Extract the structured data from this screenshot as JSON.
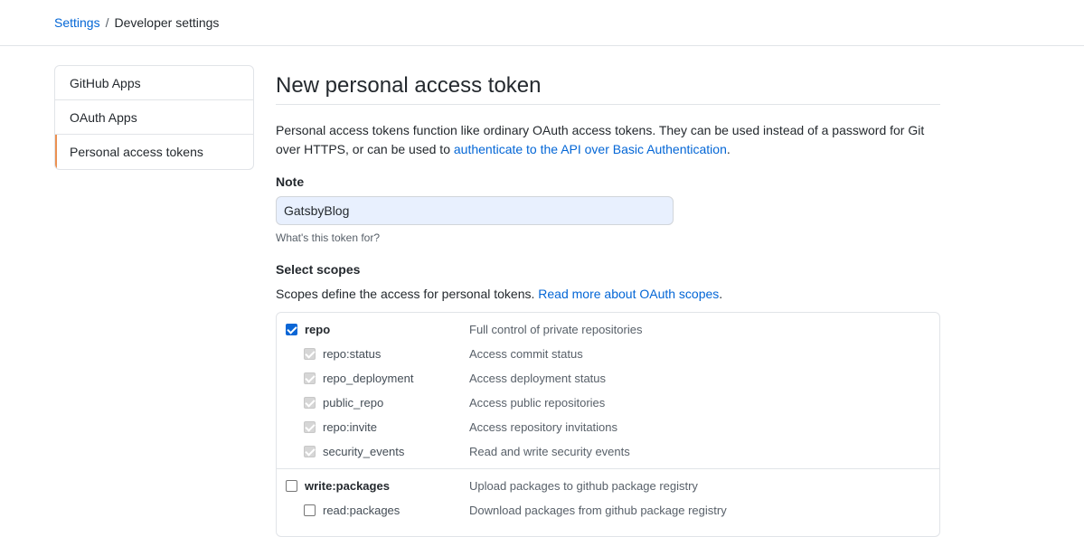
{
  "breadcrumb": {
    "root": "Settings",
    "separator": "/",
    "current": "Developer settings"
  },
  "sidebar": {
    "items": [
      {
        "label": "GitHub Apps"
      },
      {
        "label": "OAuth Apps"
      },
      {
        "label": "Personal access tokens"
      }
    ]
  },
  "main": {
    "title": "New personal access token",
    "description_prefix": "Personal access tokens function like ordinary OAuth access tokens. They can be used instead of a password for Git over HTTPS, or can be used to ",
    "description_link": "authenticate to the API over Basic Authentication",
    "description_suffix": ".",
    "note_label": "Note",
    "note_value": "GatsbyBlog",
    "note_hint": "What's this token for?",
    "scopes_label": "Select scopes",
    "scopes_desc_prefix": "Scopes define the access for personal tokens. ",
    "scopes_desc_link": "Read more about OAuth scopes",
    "scopes_desc_suffix": ".",
    "scope_groups": [
      {
        "name": "repo",
        "desc": "Full control of private repositories",
        "checked": true,
        "children": [
          {
            "name": "repo:status",
            "desc": "Access commit status"
          },
          {
            "name": "repo_deployment",
            "desc": "Access deployment status"
          },
          {
            "name": "public_repo",
            "desc": "Access public repositories"
          },
          {
            "name": "repo:invite",
            "desc": "Access repository invitations"
          },
          {
            "name": "security_events",
            "desc": "Read and write security events"
          }
        ]
      },
      {
        "name": "write:packages",
        "desc": "Upload packages to github package registry",
        "checked": false,
        "children": [
          {
            "name": "read:packages",
            "desc": "Download packages from github package registry"
          }
        ]
      }
    ]
  },
  "colors": {
    "link": "#0366d6",
    "checkbox_checked": "#0a66d6",
    "sidebar_selected_accent": "#e36209",
    "note_input_bg": "#e8f0fe"
  }
}
